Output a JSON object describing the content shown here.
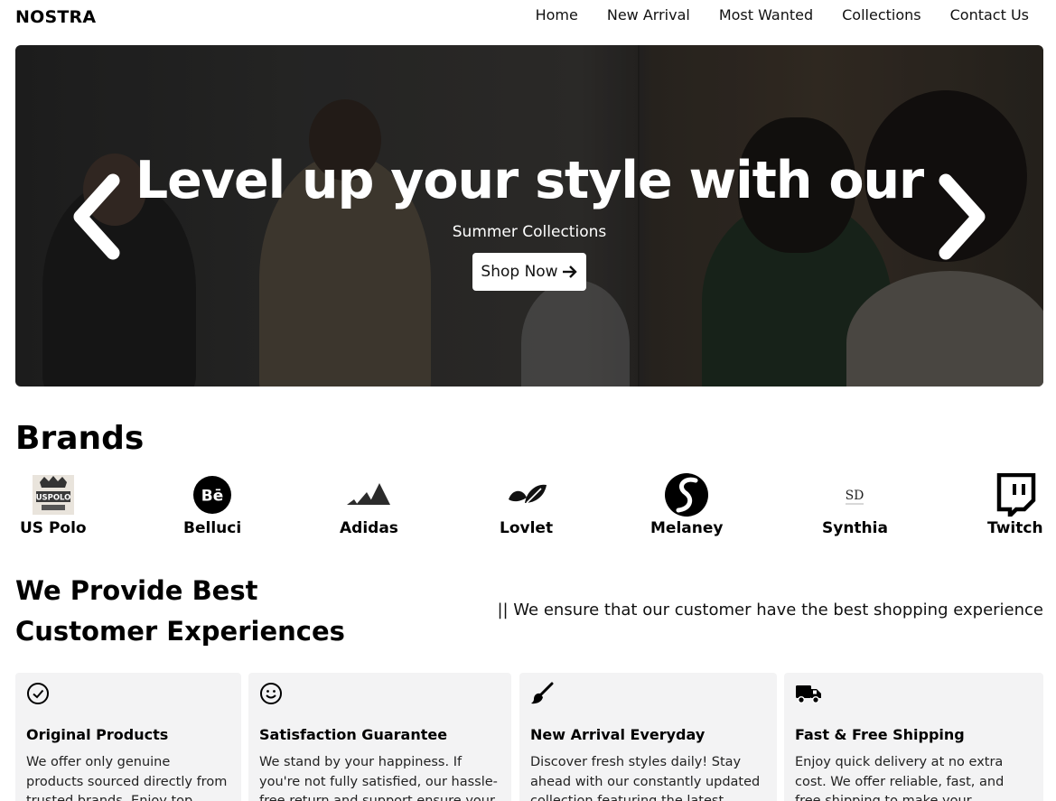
{
  "header": {
    "logo": "NOSTRA",
    "nav": [
      "Home",
      "New Arrival",
      "Most Wanted",
      "Collections",
      "Contact Us"
    ]
  },
  "hero": {
    "title": "Level up your style with our",
    "subtitle": "Summer Collections",
    "cta_label": "Shop Now",
    "cta_icon": "arrow-right-icon",
    "prev_icon": "chevron-left-icon",
    "next_icon": "chevron-right-icon"
  },
  "brands": {
    "title": "Brands",
    "items": [
      {
        "name": "US Polo",
        "logo_text": "USPOLO",
        "icon": "us-polo-logo"
      },
      {
        "name": "Belluci",
        "logo_text": "Bē",
        "icon": "behance-icon"
      },
      {
        "name": "Adidas",
        "icon": "adidas-icon"
      },
      {
        "name": "Lovlet",
        "icon": "leaf-icon"
      },
      {
        "name": "Melaney",
        "icon": "s-circle-icon"
      },
      {
        "name": "Synthia",
        "logo_text": "SD",
        "icon": "sd-monogram-logo"
      },
      {
        "name": "Twitch",
        "icon": "twitch-icon"
      }
    ]
  },
  "experience": {
    "title_line1": "We Provide Best",
    "title_line2": "Customer Experiences",
    "tagline": "|| We ensure that our customer have the best shopping experience",
    "cards": [
      {
        "icon": "check-circle-icon",
        "title": "Original Products",
        "desc": "We offer only genuine products sourced directly from trusted brands. Enjoy top quality with"
      },
      {
        "icon": "smile-icon",
        "title": "Satisfaction Guarantee",
        "desc": "We stand by your happiness. If you're not fully satisfied, our hassle-free return and support ensure your"
      },
      {
        "icon": "brush-icon",
        "title": "New Arrival Everyday",
        "desc": "Discover fresh styles daily! Stay ahead with our constantly updated collection featuring the latest trends"
      },
      {
        "icon": "truck-icon",
        "title": "Fast & Free Shipping",
        "desc": "Enjoy quick delivery at no extra cost. We offer reliable, fast, and free shipping to make your shopping"
      }
    ]
  }
}
